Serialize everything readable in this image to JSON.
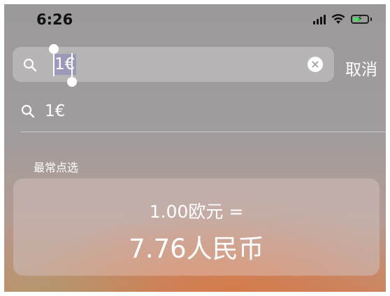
{
  "status_bar": {
    "time": "6:26",
    "battery_color": "#4cd964"
  },
  "search": {
    "query": "1€",
    "cancel_label": "取消"
  },
  "suggestion": {
    "text": "1€"
  },
  "section": {
    "label": "最常点选"
  },
  "result": {
    "line1": "1.00欧元 =",
    "line2": "7.76人民币"
  }
}
